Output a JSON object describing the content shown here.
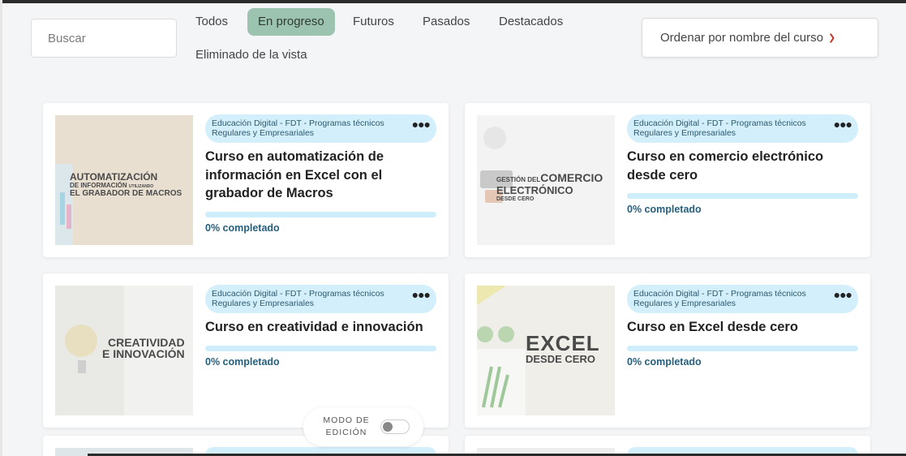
{
  "search": {
    "placeholder": "Buscar"
  },
  "tabs": [
    {
      "label": "Todos",
      "active": false
    },
    {
      "label": "En progreso",
      "active": true
    },
    {
      "label": "Futuros",
      "active": false
    },
    {
      "label": "Pasados",
      "active": false
    },
    {
      "label": "Destacados",
      "active": false
    },
    {
      "label": "Eliminado de la vista",
      "active": false
    }
  ],
  "sort": {
    "label": "Ordenar por nombre del curso",
    "icon": "chevron-down-icon"
  },
  "courses": [
    {
      "category": "Educación Digital - FDT - Programas técnicos Regulares y Empresariales",
      "title": "Curso en automatización de información en Excel con el grabador de Macros",
      "progress": 0,
      "progress_label": "0% completado",
      "thumb": {
        "line1": "AUTOMATIZACIÓN",
        "line2": "DE INFORMACIÓN",
        "line2b": "UTILIZANDO",
        "line3": "EL GRABADOR DE MACROS"
      }
    },
    {
      "category": "Educación Digital - FDT - Programas técnicos Regulares y Empresariales",
      "title": "Curso en comercio electrónico desde cero",
      "progress": 0,
      "progress_label": "0% completado",
      "thumb": {
        "line1": "GESTIÓN DEL",
        "line1b": "COMERCIO",
        "line2": "ELECTRÓNICO",
        "line3": "DESDE CERO"
      }
    },
    {
      "category": "Educación Digital - FDT - Programas técnicos Regulares y Empresariales",
      "title": "Curso en creatividad e innovación",
      "progress": 0,
      "progress_label": "0% completado",
      "thumb": {
        "line1": "CREATIVIDAD",
        "line2": "E INNOVACIÓN"
      }
    },
    {
      "category": "Educación Digital - FDT - Programas técnicos Regulares y Empresariales",
      "title": "Curso en Excel desde cero",
      "progress": 0,
      "progress_label": "0% completado",
      "thumb": {
        "line1": "EXCEL",
        "line2": "DESDE CERO"
      }
    }
  ],
  "menu_icon": "more-dots-icon",
  "edit_mode": {
    "label": "MODO DE EDICIÓN",
    "enabled": false
  },
  "colors": {
    "active_tab": "#9cc3b0",
    "tag_bg": "#d3effb",
    "progress_bg": "#cdeefa",
    "progress_text": "#265f7d",
    "sort_chevron": "#c0392b"
  }
}
